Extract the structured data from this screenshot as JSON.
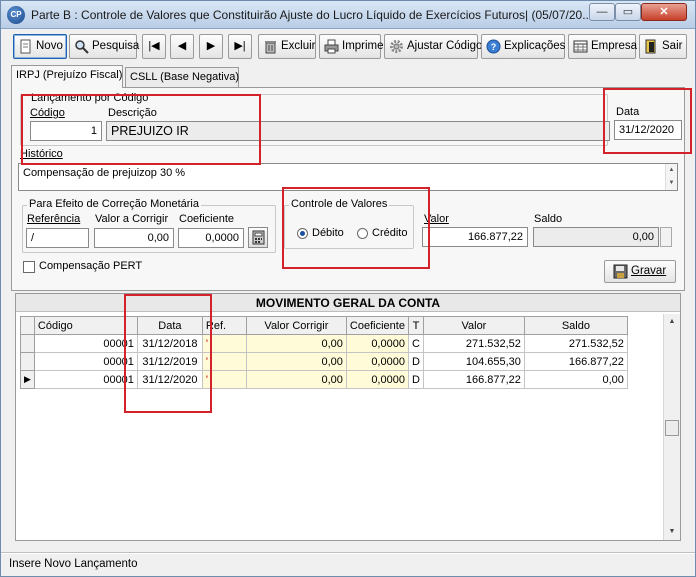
{
  "window": {
    "title": "Parte B : Controle de Valores que Constituirão Ajuste do Lucro Líquido de Exercícios Futuros| (05/07/20...",
    "app_icon_text": "CP",
    "min_glyph": "—",
    "max_glyph": "▭",
    "close_glyph": "✕"
  },
  "toolbar": {
    "novo": "Novo",
    "pesquisa": "Pesquisa",
    "first": "|◀",
    "prev": "◀",
    "next": "▶",
    "last": "▶|",
    "excluir": "Excluir",
    "imprime": "Imprime",
    "ajustar_codigo": "Ajustar Código",
    "explicacoes": "Explicações",
    "empresa": "Empresa",
    "sair": "Sair"
  },
  "tabs": {
    "irpj": "IRPJ (Prejuízo Fiscal)",
    "csll": "CSLL (Base Negativa)"
  },
  "form": {
    "lancamento_label": "Lançamento por Código",
    "codigo_label": "Código",
    "codigo_value": "1",
    "descricao_label": "Descrição",
    "descricao_value": "PREJUIZO IR",
    "data_label": "Data",
    "data_value": "31/12/2020",
    "historico_label": "Histórico",
    "historico_value": "Compensação de prejuizop 30 %",
    "correcao_group": "Para Efeito de Correção Monetária",
    "referencia_label": "Referência",
    "referencia_value": "/",
    "valor_corrigir_label": "Valor a Corrigir",
    "valor_corrigir_value": "0,00",
    "coeficiente_label": "Coeficiente",
    "coeficiente_value": "0,0000",
    "controle_group": "Controle de Valores",
    "debito_label": "Débito",
    "credito_label": "Crédito",
    "selected": "Débito",
    "valor_label": "Valor",
    "valor_value": "166.877,22",
    "saldo_label": "Saldo",
    "saldo_value": "0,00",
    "compensacao_pert_label": "Compensação PERT",
    "compensacao_pert_checked": false,
    "gravar_label": "Gravar"
  },
  "grid": {
    "title": "MOVIMENTO GERAL DA CONTA",
    "columns": [
      "Código",
      "Data",
      "Ref.",
      "Valor Corrigir",
      "Coeficiente",
      "T",
      "Valor",
      "Saldo"
    ],
    "rows": [
      {
        "indicator": "",
        "codigo": "00001",
        "data": "31/12/2018",
        "ref": "'",
        "valor_corrigir": "0,00",
        "coeficiente": "0,0000",
        "t": "C",
        "valor": "271.532,52",
        "saldo": "271.532,52"
      },
      {
        "indicator": "",
        "codigo": "00001",
        "data": "31/12/2019",
        "ref": "'",
        "valor_corrigir": "0,00",
        "coeficiente": "0,0000",
        "t": "D",
        "valor": "104.655,30",
        "saldo": "166.877,22"
      },
      {
        "indicator": "▶",
        "codigo": "00001",
        "data": "31/12/2020",
        "ref": "'",
        "valor_corrigir": "0,00",
        "coeficiente": "0,0000",
        "t": "D",
        "valor": "166.877,22",
        "saldo": "0,00"
      }
    ]
  },
  "status": {
    "text": "Insere Novo Lançamento"
  }
}
